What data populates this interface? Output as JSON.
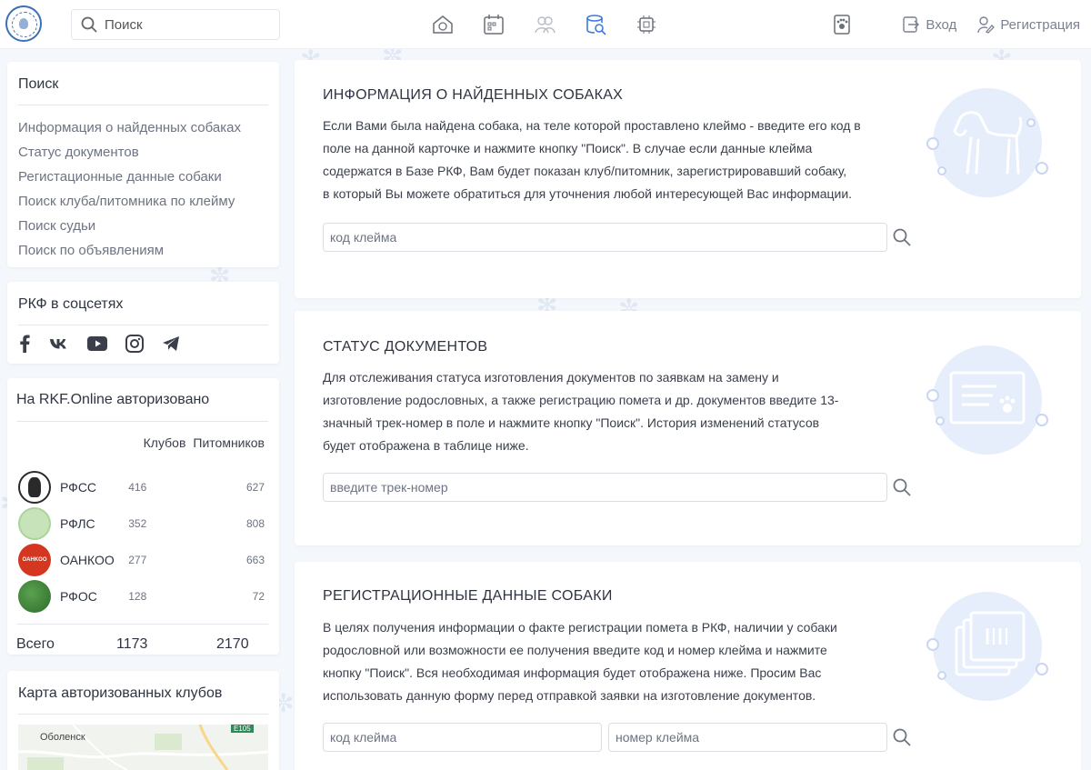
{
  "header": {
    "search_placeholder": "Поиск",
    "login_label": "Вход",
    "register_label": "Регистрация",
    "nav_icons": [
      "home-icon",
      "calendar-icon",
      "people-icon",
      "database-search-icon",
      "chip-icon"
    ]
  },
  "sidebar": {
    "search_card": {
      "title": "Поиск",
      "items": [
        "Информация о найденных собаках",
        "Статус документов",
        "Регистационные данные собаки",
        "Поиск клуба/питомника по клейму",
        "Поиск судьи",
        "Поиск по объявлениям"
      ]
    },
    "social_card": {
      "title": "РКФ в соцсетях",
      "icons": [
        "facebook-icon",
        "vk-icon",
        "youtube-icon",
        "instagram-icon",
        "telegram-icon"
      ]
    },
    "stats_card": {
      "title": "На RKF.Online авторизовано",
      "col_clubs": "Клубов",
      "col_kennels": "Питомников",
      "rows": [
        {
          "name": "РФСС",
          "clubs": "416",
          "kennels": "627",
          "logo_color": "#2a2a2a"
        },
        {
          "name": "РФЛС",
          "clubs": "352",
          "kennels": "808",
          "logo_color": "#a9d49a"
        },
        {
          "name": "ОАНКОО",
          "clubs": "277",
          "kennels": "663",
          "logo_color": "#d4361f",
          "logo_text": "OAHKOO"
        },
        {
          "name": "РФОС",
          "clubs": "128",
          "kennels": "72",
          "logo_color": "#3f8a3a"
        }
      ],
      "total_label": "Всего",
      "total_clubs": "1173",
      "total_kennels": "2170"
    },
    "map_card": {
      "title": "Карта авторизованных клубов",
      "map_label_city": "Оболенск",
      "map_label_road": "E105"
    }
  },
  "cards": [
    {
      "title": "ИНФОРМАЦИЯ О НАЙДЕННЫХ СОБАКАХ",
      "lines": [
        "Если Вами была найдена собака, на теле которой проставлено клеймо - введите его код в",
        "поле на данной карточке и нажмите кнопку \"Поиск\". В случае если данные клейма",
        "содержатся в Базе РКФ, Вам будет показан клуб/питомник, зарегистрировавший собаку,",
        "в который Вы можете обратиться для уточнения любой интересующей Вас информации."
      ],
      "placeholder": "код клейма"
    },
    {
      "title": "СТАТУС ДОКУМЕНТОВ",
      "lines": [
        "Для отслеживания статуса изготовления документов по заявкам на замену и",
        "изготовление родословных, а также регистрацию помета и др. документов введите 13-",
        "значный трек-номер в поле и нажмите кнопку \"Поиск\". История изменений статусов",
        "будет отображена в таблице ниже."
      ],
      "placeholder": "введите трек-номер"
    },
    {
      "title": "РЕГИСТРАЦИОННЫЕ ДАННЫЕ СОБАКИ",
      "lines": [
        "В целях получения информации о факте регистрации помета в РКФ, наличии у собаки",
        "родословной или возможности ее получения введите код и номер клейма и нажмите",
        "кнопку \"Поиск\". Вся необходимая информация будет отображена ниже. Просим Вас",
        "использовать данную форму перед отправкой заявки на изготовление документов."
      ],
      "placeholder_code": "код клейма",
      "placeholder_number": "номер клейма"
    }
  ],
  "colors": {
    "accent": "#4a7dd6",
    "illustration_bg": "#e8eefb",
    "illustration_line": "#c9d6f3"
  }
}
